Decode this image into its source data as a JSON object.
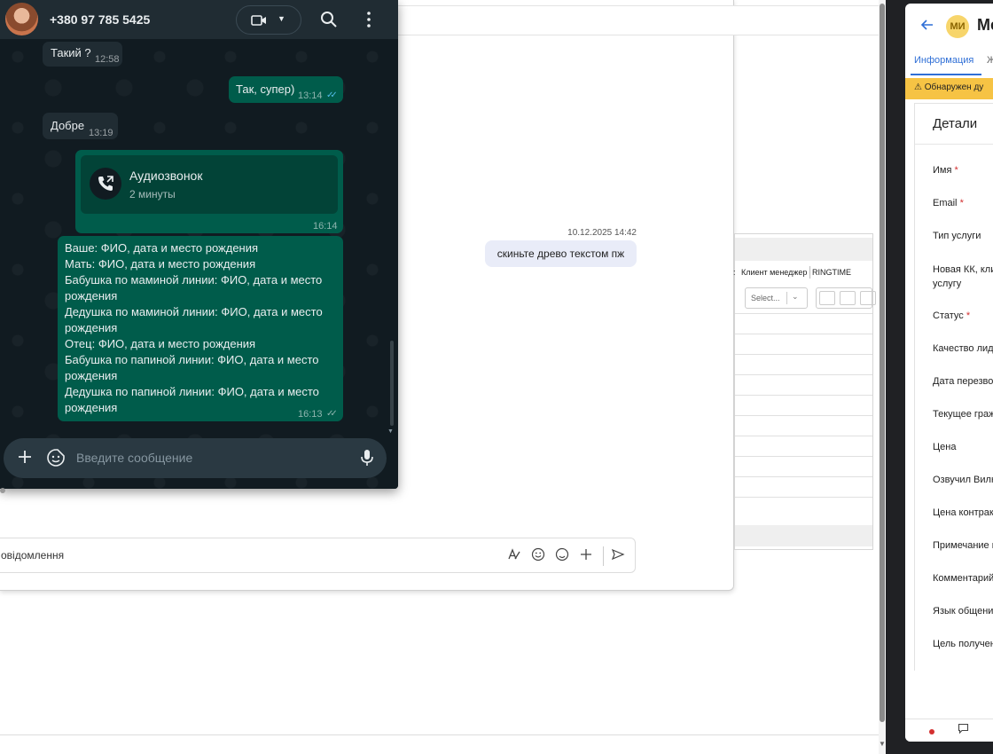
{
  "whatsapp": {
    "contact_phone": "+380 97 785 5425",
    "messages": [
      {
        "text": "Такий ?",
        "time": "12:58",
        "direction": "in"
      },
      {
        "text": "Так, супер)",
        "time": "13:14",
        "direction": "out",
        "status": "read"
      },
      {
        "text": "Добре",
        "time": "13:19",
        "direction": "in"
      }
    ],
    "call": {
      "title": "Аудиозвонок",
      "duration": "2 минуты",
      "time": "16:14"
    },
    "tree_message": {
      "lines": [
        "Ваше: ФИО, дата и место рождения",
        "Мать: ФИО, дата и место рождения",
        "Бабушка по маминой линии: ФИО, дата и место",
        "рождения",
        "Дедушка по маминой линии: ФИО, дата и место",
        "рождения",
        "Отец: ФИО, дата и место рождения",
        "Бабушка по папиной линии: ФИО, дата и место",
        "рождения",
        "Дедушка по папиной линии: ФИО, дата и место",
        "рождения"
      ],
      "time": "16:13",
      "status": "delivered"
    },
    "composer_placeholder": "Введите сообщение",
    "colors": {
      "header": "#202c33",
      "out_bubble": "#005c4b",
      "in_bubble": "#202c33",
      "read_check": "#53bdeb"
    }
  },
  "background_chat": {
    "message_time": "10.12.2025 14:42",
    "message_text": "скиньте древо текстом пж",
    "composer_placeholder": "овідомлення"
  },
  "background_table": {
    "col_client_manager": "Клиент менеджер",
    "col_ringtime": "RINGTIME",
    "select_placeholder": "Select..."
  },
  "crm": {
    "avatar_initials": "МИ",
    "name_partial": "Ме",
    "tab_info": "Информация",
    "tab_second_partial": "Ж",
    "warning_text": "Обнаружен ду",
    "card_title": "Детали",
    "fields": [
      {
        "label": "Имя",
        "required": true
      },
      {
        "label": "Email",
        "required": true
      },
      {
        "label": "Тип услуги",
        "required": false
      },
      {
        "label": "Новая КК, кли",
        "label2": "услугу",
        "required": false
      },
      {
        "label": "Статус",
        "required": true
      },
      {
        "label": "Качество лида",
        "required": false
      },
      {
        "label": "Дата перезвон",
        "required": false
      },
      {
        "label": "Текущее граж",
        "required": false
      },
      {
        "label": "Цена",
        "required": false
      },
      {
        "label": "Озвучил Вилк",
        "required": false
      },
      {
        "label": "Цена контрак",
        "required": false
      },
      {
        "label": "Примечание к",
        "required": false
      },
      {
        "label": "Комментарий",
        "required": false
      },
      {
        "label": "Язык общени",
        "required": false
      },
      {
        "label": "Цель получен",
        "required": false
      }
    ],
    "required_mark": "*",
    "colors": {
      "accent": "#2f6fd6",
      "warning": "#f6c344",
      "required": "#d32f2f"
    }
  }
}
